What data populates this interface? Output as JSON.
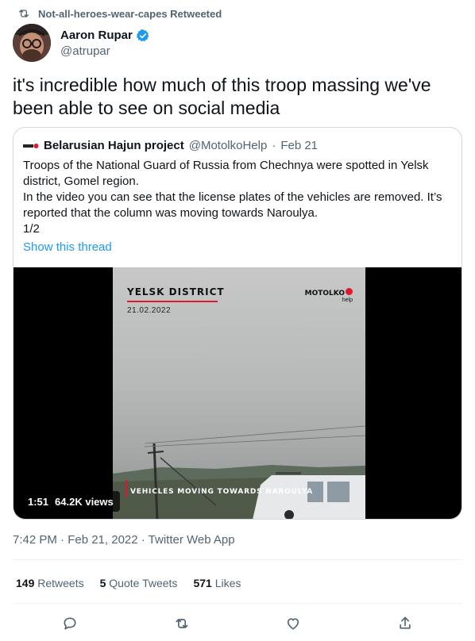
{
  "retweet_context": {
    "text": "Not-all-heroes-wear-capes Retweeted",
    "icon": "retweet-icon"
  },
  "author": {
    "name": "Aaron Rupar",
    "handle": "@atrupar",
    "verified": true
  },
  "tweet": {
    "text": "it's incredible how much of this troop massing we've been able to see on social media",
    "timestamp": "7:42 PM · Feb 21, 2022 · Twitter Web App"
  },
  "quoted_tweet": {
    "author_name": "Belarusian Hajun project",
    "handle": "@MotolkoHelp",
    "separator": "·",
    "date": "Feb 21",
    "paragraphs": [
      "Troops of the National Guard of Russia from Chechnya were spotted in Yelsk district, Gomel region.",
      "In the video you can see that the license plates of the vehicles are removed. It’s reported that the column was moving towards Naroulya.",
      "1/2"
    ],
    "show_thread": "Show this thread"
  },
  "video": {
    "overlay_title": "Yelsk district",
    "overlay_date": "21.02.2022",
    "overlay_logo": "MOTOLKO",
    "overlay_logo_sub": "help",
    "caption": "Vehicles moving towards Naroulya",
    "duration": "1:51",
    "views": "64.2K views"
  },
  "stats": {
    "retweets_count": "149",
    "retweets_label": "Retweets",
    "quotes_count": "5",
    "quotes_label": "Quote Tweets",
    "likes_count": "571",
    "likes_label": "Likes"
  },
  "actions": [
    "reply-icon",
    "retweet-icon",
    "like-icon",
    "share-icon"
  ],
  "colors": {
    "accent": "#1d9bf0",
    "secondary_text": "#536471",
    "primary_text": "#0f1419",
    "border": "#cfd9de"
  }
}
